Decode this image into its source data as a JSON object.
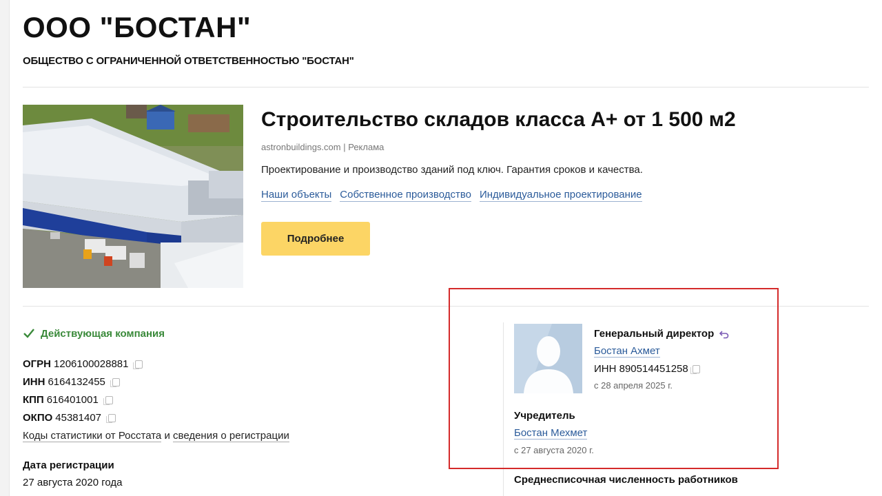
{
  "company": {
    "short_name": "ООО \"БОСТАН\"",
    "full_name": "ОБЩЕСТВО С ОГРАНИЧЕННОЙ ОТВЕТСТВЕННОСТЬЮ \"БОСТАН\""
  },
  "ad": {
    "title": "Строительство складов класса А+ от 1 500 м2",
    "source": "astronbuildings.com | Реклама",
    "description": "Проектирование и производство зданий под ключ. Гарантия сроков и качества.",
    "links": [
      "Наши объекты",
      "Собственное производство",
      "Индивидуальное проектирование"
    ],
    "button_label": "Подробнее"
  },
  "status": {
    "label": "Действующая компания",
    "color": "#3a8a3a"
  },
  "requisites": [
    {
      "label": "ОГРН",
      "value": "1206100028881"
    },
    {
      "label": "ИНН",
      "value": "6164132455"
    },
    {
      "label": "КПП",
      "value": "616401001"
    },
    {
      "label": "ОКПО",
      "value": "45381407"
    }
  ],
  "stats_line": {
    "link1": "Коды статистики от Росстата",
    "conj": "и",
    "link2": "сведения о регистрации"
  },
  "registration": {
    "label": "Дата регистрации",
    "value": "27 августа 2020 года"
  },
  "director": {
    "role": "Генеральный директор",
    "name": "Бостан Ахмет",
    "inn": "ИНН 890514451258",
    "since": "с 28 апреля 2025 г."
  },
  "founder": {
    "label": "Учредитель",
    "name": "Бостан Мехмет",
    "since": "с 27 августа 2020 г."
  },
  "employees": {
    "label": "Среднесписочная численность работников"
  },
  "colors": {
    "link": "#2b5b9a",
    "button": "#fcd565",
    "highlight": "#d42a2a"
  }
}
